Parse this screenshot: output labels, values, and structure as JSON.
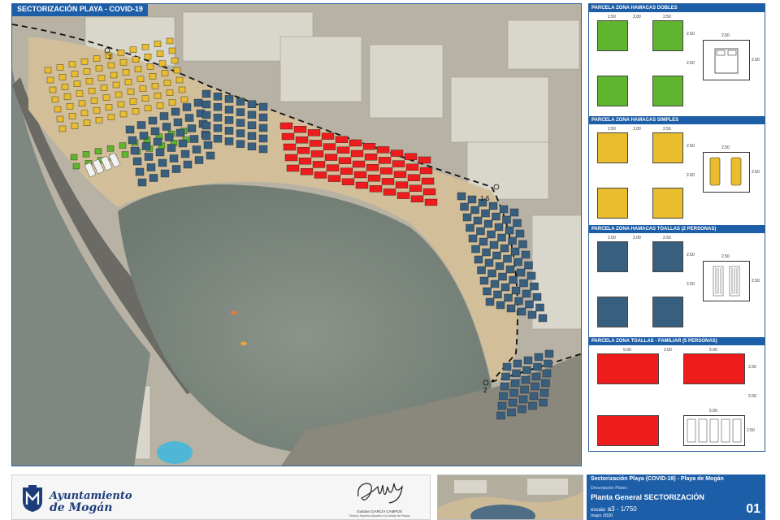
{
  "map": {
    "title": "SECTORIZACIÓN PLAYA  -  COVID-19",
    "marker_2_top": "2",
    "marker_2_bottom": "2",
    "marker_15": "1-5"
  },
  "legend": {
    "sections": [
      {
        "title": "PARCELA ZONA HAMACAS DOBLES",
        "color": "#5fb52d",
        "dim_top_left": "2.50",
        "dim_gap": "2.00",
        "dim_top_right": "2.50",
        "dim_side": "2.50",
        "dim_mid": "2.00",
        "detail_w": "2.50",
        "detail_h": "2.50"
      },
      {
        "title": "PARCELA ZONA HAMACAS SIMPLES",
        "color": "#e9bd2e",
        "dim_top_left": "2.50",
        "dim_gap": "2.00",
        "dim_top_right": "2.50",
        "dim_side": "2.50",
        "dim_mid": "2.00",
        "detail_w": "2.50",
        "detail_h": "2.50"
      },
      {
        "title": "PARCELA ZONA HAMACAS TOALLAS (2 PERSONAS)",
        "color": "#395f7f",
        "dim_top_left": "2.50",
        "dim_gap": "2.00",
        "dim_top_right": "2.50",
        "dim_side": "2.50",
        "dim_mid": "2.00",
        "detail_w": "2.50",
        "detail_h": "2.50"
      },
      {
        "title": "PARCELA ZONA TOALLAS - FAMILIAR (5 PERSONAS)",
        "color": "#ee1c1c",
        "dim_top_left": "5.00",
        "dim_gap": "2.00",
        "dim_top_right": "5.00",
        "dim_side": "2.50",
        "dim_mid": "2.00",
        "detail_w": "5.00",
        "detail_h": "2.50"
      }
    ]
  },
  "footer": {
    "logo_line1": "Ayuntamiento",
    "logo_line2": "de Mogán",
    "signer_name": "Gustavo GARCÍA CAMPOS",
    "signer_role": "Técnico Superior Adscrito a la Unidad de Playas",
    "project_title": "Sectorización Playa (COVID-19)  -  Playa de Mogán",
    "desc_label": "Descripción Plano:",
    "plan_name": "Planta General SECTORIZACIÓN",
    "scale_label": "escala:",
    "scale_value": "a3  -  1/750",
    "date": "mayo 2020",
    "sheet_number": "01"
  }
}
